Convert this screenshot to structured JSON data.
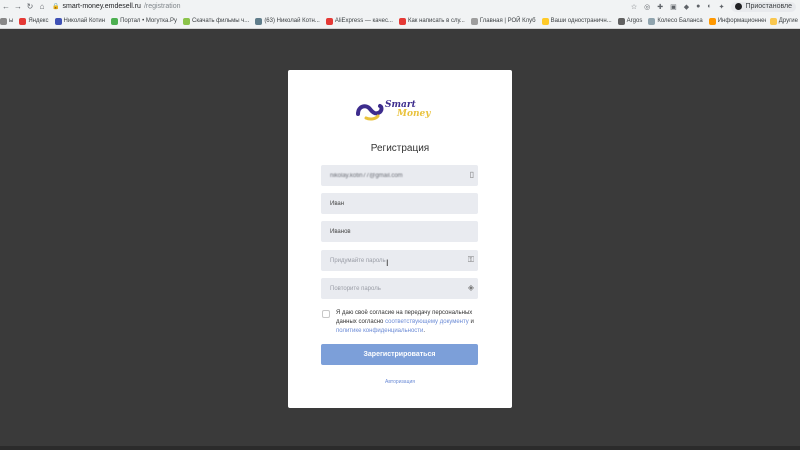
{
  "browser": {
    "url_host": "smart-money.emdesell.ru",
    "url_path": "/registration",
    "profile_label": "Приостановле",
    "bookmarks": [
      {
        "label": "ы",
        "color": "#888888"
      },
      {
        "label": "Яндекс",
        "color": "#e53935"
      },
      {
        "label": "Николай Котин",
        "color": "#3f51b5"
      },
      {
        "label": "Портал • Могутка.Ру",
        "color": "#4caf50"
      },
      {
        "label": "Скачать фильмы ч...",
        "color": "#8bc34a"
      },
      {
        "label": "(63) Николай Котн...",
        "color": "#607d8b"
      },
      {
        "label": "AliExpress — качес...",
        "color": "#e53935"
      },
      {
        "label": "Как написать в слу...",
        "color": "#e53935"
      },
      {
        "label": "Главная | РОЙ Клуб",
        "color": "#9e9e9e"
      },
      {
        "label": "Ваши одностраничн...",
        "color": "#ffca28"
      },
      {
        "label": "Argos",
        "color": "#616161"
      },
      {
        "label": "Колесо Баланса",
        "color": "#90a4ae"
      },
      {
        "label": "Информационнее...",
        "color": "#ff9800"
      }
    ],
    "other_bookmarks": "Другие"
  },
  "logo": {
    "line1": "Smart",
    "line2": "Money"
  },
  "form": {
    "title": "Регистрация",
    "email_value": "nikolay.kotin77@gmail.com",
    "first_name_value": "Иван",
    "last_name_value": "Иванов",
    "password_placeholder": "Придумайте пароль",
    "password_repeat_placeholder": "Повторите пароль",
    "consent_text_1": "Я даю своё согласие на передачу персональных данных согласно ",
    "consent_link_1": "соответствующему документу",
    "consent_text_2": " и ",
    "consent_link_2": "политике конфиденциальности",
    "consent_text_3": ".",
    "submit_label": "Зарегистрироваться",
    "login_link": "Авторизация"
  }
}
